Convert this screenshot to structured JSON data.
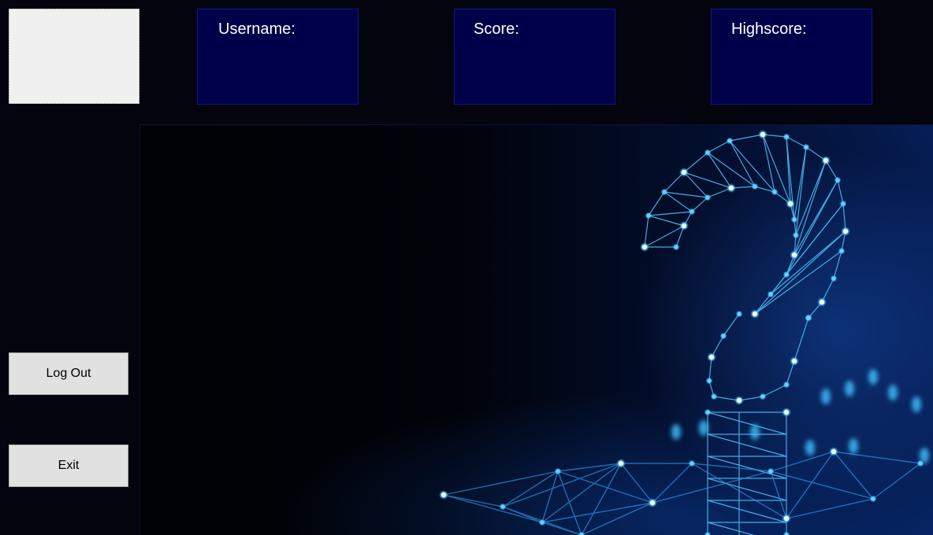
{
  "header": {
    "username_label": "Username:",
    "username_value": "",
    "score_label": "Score:",
    "score_value": "",
    "highscore_label": "Highscore:",
    "highscore_value": ""
  },
  "sidebar": {
    "logout_label": "Log Out",
    "exit_label": "Exit"
  },
  "hero": {
    "depicts": "glowing network question mark"
  },
  "colors": {
    "background": "#03040d",
    "stat_box": "#00004a",
    "stat_border": "#0b1a8a",
    "button": "#e1e1e1",
    "glow": "#3fc3ff"
  }
}
